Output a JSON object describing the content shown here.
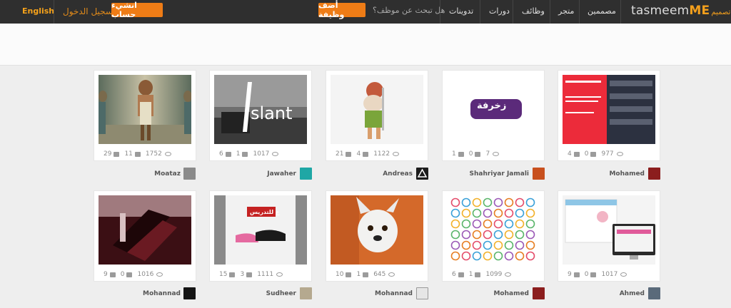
{
  "header": {
    "language": "English",
    "login": "تسجيل الدخول",
    "signup": "انشيء حساب",
    "add_job": "أضف وظيفة",
    "search_prompt": "هل تبحث عن موظف؟",
    "nav": [
      "تدوينات",
      "دورات",
      "وظائف",
      "متجر",
      "مصممين"
    ],
    "logo_main": "tasmeem",
    "logo_me": "ME",
    "logo_ar": "تصميم"
  },
  "cards": [
    {
      "likes": "29",
      "comments": "11",
      "views": "1752",
      "author": "Moataz"
    },
    {
      "likes": "6",
      "comments": "1",
      "views": "1017",
      "author": "Jawaher"
    },
    {
      "likes": "21",
      "comments": "4",
      "views": "1122",
      "author": "Andreas"
    },
    {
      "likes": "1",
      "comments": "0",
      "views": "7",
      "author": "Shahriyar Jamali"
    },
    {
      "likes": "4",
      "comments": "0",
      "views": "977",
      "author": "Mohamed"
    },
    {
      "likes": "9",
      "comments": "0",
      "views": "1016",
      "author": "Mohannad"
    },
    {
      "likes": "15",
      "comments": "3",
      "views": "1111",
      "author": "Sudheer"
    },
    {
      "likes": "10",
      "comments": "1",
      "views": "645",
      "author": "Mohannad"
    },
    {
      "likes": "6",
      "comments": "1",
      "views": "1099",
      "author": "Mohamed"
    },
    {
      "likes": "9",
      "comments": "0",
      "views": "1017",
      "author": "Ahmed"
    }
  ],
  "thumbs": {
    "slant_text": "slant",
    "zakhrafa_text": "زخرفة",
    "shoes_label": "ع للتدريس"
  }
}
